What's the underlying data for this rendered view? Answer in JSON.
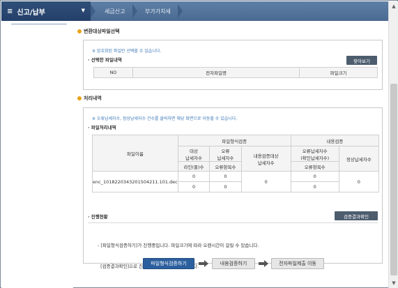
{
  "topbar": {
    "menu_label": "신고/납부",
    "crumbs": [
      "세금신고",
      "부가가치세"
    ]
  },
  "section1": {
    "title": "변환대상파일선택",
    "note": "※ 암호화된 파일만 선택할 수 있습니다.",
    "subtitle": "선택한 파일내역",
    "browse_label": "찾아보기",
    "headers": [
      "NO",
      "전자파일명",
      "파일크기"
    ]
  },
  "section2": {
    "title": "처리내역",
    "note": "※ 오류납세자수, 정상납세자수 건수를 클릭하면 해당 화면으로 이동할 수 있습니다.",
    "subtitle": "파일처리내역",
    "table": {
      "col_filename": "파일이름",
      "group_format": "파일형식검증",
      "group_content": "내용검증",
      "target_taxpayers": "대상\n납세자수",
      "error_taxpayers": "오류\n납세자수",
      "content_target": "내용검증대상\n납세자수",
      "content_error": "오류납세자수\n(확인납세자수)",
      "normal_taxpayers": "정상납세자수",
      "line_count": "라인(줄)수",
      "error_items": "오류항목수",
      "error_items2": "오류항목수",
      "row": {
        "filename": "enc_1018220343201504211.101.dec",
        "target_top": "0",
        "target_bottom": "0",
        "error_top": "0",
        "error_bottom": "0",
        "content_target": "0",
        "content_error_top": "0",
        "content_error_bottom": "0",
        "normal": "0"
      }
    }
  },
  "progress": {
    "title": "진행현황",
    "result_button": "검증결과확인",
    "lines": [
      "- [파일형식검증하기]가 진행중입니다. 파일크기에 따라 오랜시간이 걸릴 수 있습니다.",
      "  [검증결과확인]으로 진행상황을 확인할 수 있습니다."
    ]
  },
  "steps": {
    "step1": "파일형식검증하기",
    "step2": "내용검증하기",
    "step3": "전자파일제출 이동"
  },
  "colors": {
    "topbar": "#4a6a91",
    "menu": "#24406a",
    "accent_dot": "#e8a317",
    "note_blue": "#3c78b8",
    "primary_button": "#2c5f9e"
  }
}
